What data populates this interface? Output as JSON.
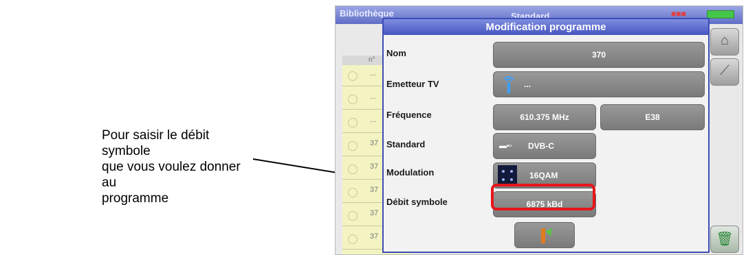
{
  "callout": {
    "line1": "Pour saisir le débit symbole",
    "line2": "que vous voulez donner au",
    "line3": "programme"
  },
  "device": {
    "topbar_left": "Bibliothèque",
    "topbar_mid": "Standard",
    "dialog_title": "Modification programme",
    "bg_rows": [
      "...",
      "...",
      "...",
      "37",
      "37",
      "37",
      "37",
      "37"
    ],
    "bg_header_label": "n°",
    "fields": {
      "nom_label": "Nom",
      "nom_value": "370",
      "emetteur_label": "Emetteur TV",
      "emetteur_value": "...",
      "frequence_label": "Fréquence",
      "frequence_value": "610.375 MHz",
      "canal_value": "E38",
      "standard_label": "Standard",
      "standard_value": "DVB-C",
      "modulation_label": "Modulation",
      "modulation_value": "16QAM",
      "debit_label": "Débit symbole",
      "debit_value": "6875 kBd"
    },
    "icons": [
      "home-icon",
      "satellite-dish-icon",
      "antenna-icon",
      "constellation-icon",
      "trash-icon"
    ]
  }
}
